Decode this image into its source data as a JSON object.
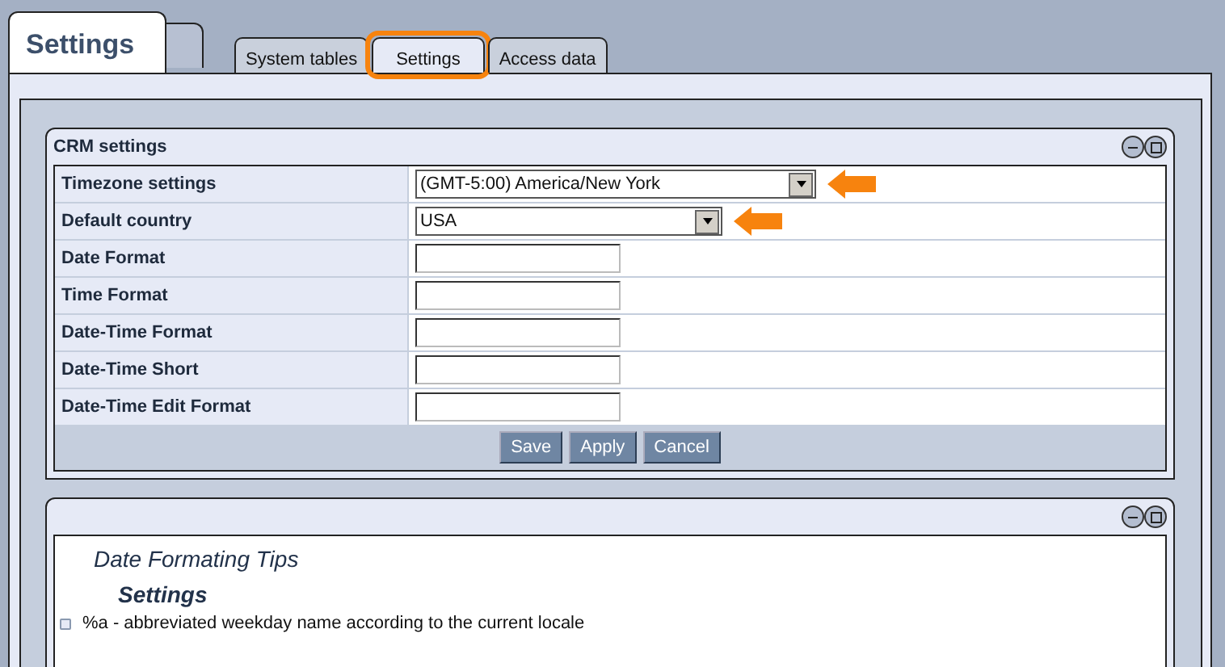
{
  "page_tab": {
    "label": "Settings"
  },
  "tabs": [
    {
      "label": "System tables",
      "selected": false,
      "highlighted": false
    },
    {
      "label": "Settings",
      "selected": true,
      "highlighted": true
    },
    {
      "label": "Access data",
      "selected": false,
      "highlighted": false
    }
  ],
  "crm_panel": {
    "title": "CRM settings",
    "fields": [
      {
        "label": "Timezone settings",
        "kind": "select",
        "value": "(GMT-5:00) America/New York",
        "wide": true,
        "pointed": true
      },
      {
        "label": "Default country",
        "kind": "select",
        "value": "USA",
        "wide": false,
        "pointed": true
      },
      {
        "label": "Date Format",
        "kind": "text"
      },
      {
        "label": "Time Format",
        "kind": "text"
      },
      {
        "label": "Date-Time Format",
        "kind": "text"
      },
      {
        "label": "Date-Time Short",
        "kind": "text"
      },
      {
        "label": "Date-Time Edit Format",
        "kind": "text"
      }
    ],
    "buttons": [
      "Save",
      "Apply",
      "Cancel"
    ]
  },
  "tips_panel": {
    "title": "Date Formating Tips",
    "subtitle": "Settings",
    "items": [
      "%a - abbreviated weekday name according to the current locale"
    ]
  }
}
